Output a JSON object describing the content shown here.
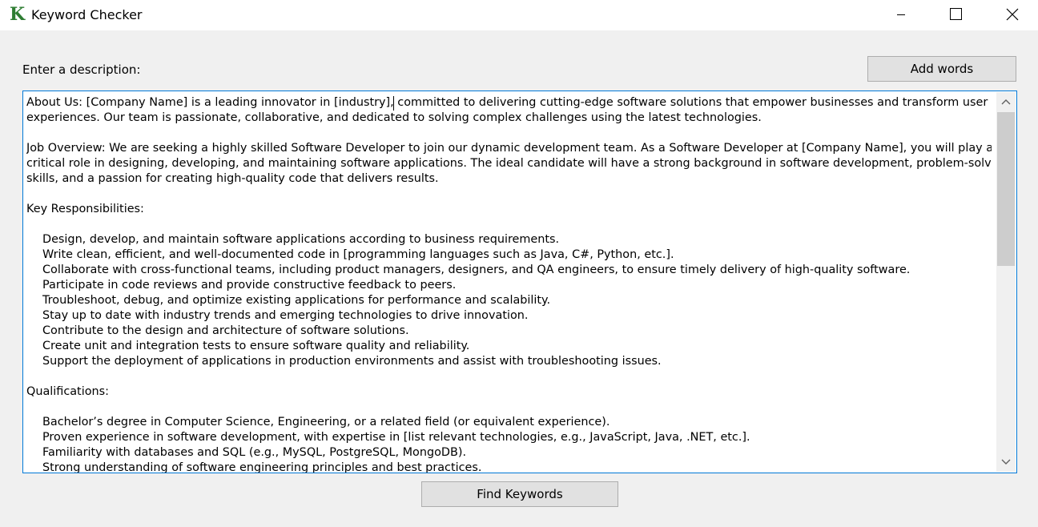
{
  "window": {
    "title": "Keyword Checker",
    "app_icon_letter": "K",
    "accent_color": "#2e7d32"
  },
  "form": {
    "description_label": "Enter a description:",
    "add_words_label": "Add words",
    "find_keywords_label": "Find Keywords"
  },
  "description": {
    "lines": [
      {
        "text": "About Us: [Company Name] is a leading innovator in [industry], committed to delivering cutting-edge software solutions that empower businesses and transform user",
        "indent": false
      },
      {
        "text": "experiences. Our team is passionate, collaborative, and dedicated to solving complex challenges using the latest technologies.",
        "indent": false
      },
      {
        "text": "",
        "indent": false
      },
      {
        "text": "Job Overview: We are seeking a highly skilled Software Developer to join our dynamic development team. As a Software Developer at [Company Name], you will play a",
        "indent": false
      },
      {
        "text": "critical role in designing, developing, and maintaining software applications. The ideal candidate will have a strong background in software development, problem-solving",
        "indent": false
      },
      {
        "text": "skills, and a passion for creating high-quality code that delivers results.",
        "indent": false
      },
      {
        "text": "",
        "indent": false
      },
      {
        "text": "Key Responsibilities:",
        "indent": false
      },
      {
        "text": "",
        "indent": false
      },
      {
        "text": "Design, develop, and maintain software applications according to business requirements.",
        "indent": true
      },
      {
        "text": "Write clean, efficient, and well-documented code in [programming languages such as Java, C#, Python, etc.].",
        "indent": true
      },
      {
        "text": "Collaborate with cross-functional teams, including product managers, designers, and QA engineers, to ensure timely delivery of high-quality software.",
        "indent": true
      },
      {
        "text": "Participate in code reviews and provide constructive feedback to peers.",
        "indent": true
      },
      {
        "text": "Troubleshoot, debug, and optimize existing applications for performance and scalability.",
        "indent": true
      },
      {
        "text": "Stay up to date with industry trends and emerging technologies to drive innovation.",
        "indent": true
      },
      {
        "text": "Contribute to the design and architecture of software solutions.",
        "indent": true
      },
      {
        "text": "Create unit and integration tests to ensure software quality and reliability.",
        "indent": true
      },
      {
        "text": "Support the deployment of applications in production environments and assist with troubleshooting issues.",
        "indent": true
      },
      {
        "text": "",
        "indent": false
      },
      {
        "text": "Qualifications:",
        "indent": false
      },
      {
        "text": "",
        "indent": false
      },
      {
        "text": "Bachelor’s degree in Computer Science, Engineering, or a related field (or equivalent experience).",
        "indent": true
      },
      {
        "text": "Proven experience in software development, with expertise in [list relevant technologies, e.g., JavaScript, Java, .NET, etc.].",
        "indent": true
      },
      {
        "text": "Familiarity with databases and SQL (e.g., MySQL, PostgreSQL, MongoDB).",
        "indent": true
      },
      {
        "text": "Strong understanding of software engineering principles and best practices.",
        "indent": true
      }
    ]
  },
  "scrollbar": {
    "position_fraction": 0.0,
    "visible_fraction": 0.45
  }
}
